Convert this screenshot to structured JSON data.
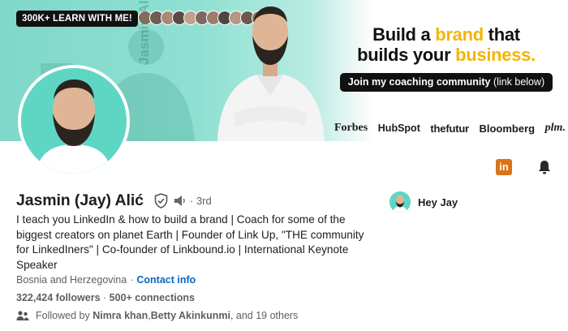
{
  "banner": {
    "badge": "300K+ LEARN WITH ME!",
    "vertical_name": "Jasmin Alić",
    "headline_part1": "Build a ",
    "headline_accent1": "brand",
    "headline_part2": " that",
    "headline_line2_part1": "builds your ",
    "headline_accent2": "business.",
    "cta_bold": "Join my coaching community",
    "cta_rest": " (link below)",
    "logos": [
      "Forbes",
      "HubSpot",
      "thefutur",
      "Bloomberg",
      "plm."
    ],
    "accent_color": "#f4b400"
  },
  "profile": {
    "name": "Jasmin (Jay) Alić",
    "degree": "· 3rd",
    "bio": "I teach you LinkedIn & how to build a brand | Coach for some of the biggest creators on planet Earth | Founder of Link Up, \"THE community for LinkedIners\" | Co-founder of Linkbound.io | International Keynote Speaker",
    "location": "Bosnia and Herzegovina",
    "separator": "·",
    "contact_label": "Contact info",
    "followers": "322,424 followers",
    "connections_sep": "·",
    "connections": "500+ connections",
    "followed_prefix": "Followed by ",
    "followed_name1": "Nimra khan",
    "followed_comma": ", ",
    "followed_name2": "Betty Akinkunmi",
    "followed_suffix": ", and 19 others"
  },
  "side": {
    "linkedin_badge": "in",
    "hey_label": "Hey Jay"
  },
  "icons": {
    "verified": "shield-check-icon",
    "pronunciation": "speaker-icon",
    "notifications": "bell-icon",
    "followers": "people-icon"
  },
  "colors": {
    "link": "#0a66c2",
    "banner_teal": "#7fd8c9",
    "linkedin_orange": "#d9731a"
  }
}
